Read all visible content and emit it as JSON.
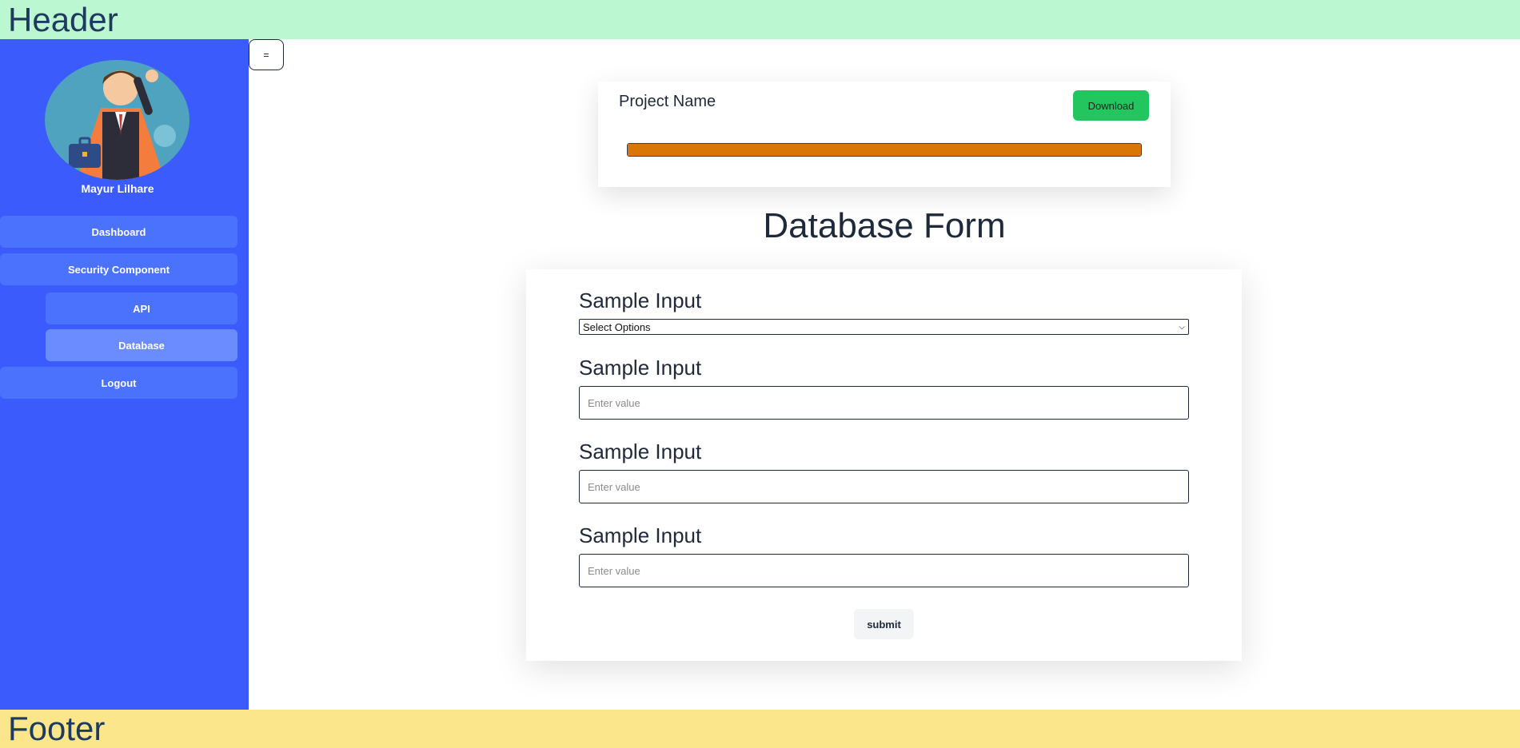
{
  "header": {
    "title": "Header"
  },
  "footer": {
    "title": "Footer"
  },
  "sidebar": {
    "username": "Mayur Lilhare",
    "items": [
      {
        "label": "Dashboard"
      },
      {
        "label": "Security Component"
      },
      {
        "label": "API"
      },
      {
        "label": "Database"
      },
      {
        "label": "Logout"
      }
    ]
  },
  "toggle": {
    "label": "="
  },
  "project": {
    "name": "Project Name",
    "download_label": "Download",
    "progress": 1.0
  },
  "form": {
    "heading": "Database Form",
    "select": {
      "label": "Sample Input",
      "value": "Select Options"
    },
    "inputs": [
      {
        "label": "Sample Input",
        "placeholder": "Enter value"
      },
      {
        "label": "Sample Input",
        "placeholder": "Enter value"
      },
      {
        "label": "Sample Input",
        "placeholder": "Enter value"
      }
    ],
    "submit_label": "submit"
  },
  "colors": {
    "header_bg": "#bbf7d0",
    "footer_bg": "#fbe68c",
    "sidebar_bg": "#3b5bfc",
    "nav_item_bg": "#4a72fd",
    "nav_item_active_bg": "#6b8cff",
    "download_bg": "#22c55e",
    "progress_fill": "#d97706"
  }
}
